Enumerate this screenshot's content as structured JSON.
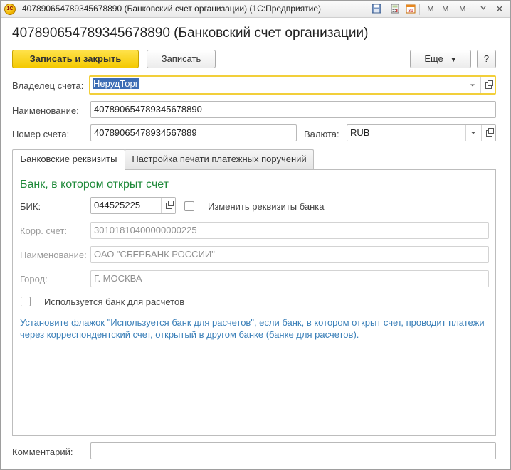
{
  "window": {
    "title": "40789065478934567889­0 (Банковский счет организации)  (1С:Предприятие)",
    "logo_text": "1С",
    "toolbar_icons": [
      "save-icon",
      "calculator-icon",
      "calendar-icon",
      "m-icon",
      "m-plus-icon",
      "m-minus-icon",
      "close-icon"
    ],
    "m_label": "M",
    "m_plus_label": "M+",
    "m_minus_label": "M−",
    "close_glyph": "✕"
  },
  "header": {
    "title": "40789065478934567889­0 (Банковский счет организации)"
  },
  "toolbar": {
    "save_close_label": "Записать и закрыть",
    "save_label": "Записать",
    "more_label": "Еще",
    "help_label": "?"
  },
  "form": {
    "owner": {
      "label": "Владелец счета:",
      "value": "НерудТорг"
    },
    "name": {
      "label": "Наименование:",
      "value": "40789065478934567889­0"
    },
    "account": {
      "label": "Номер счета:",
      "value": "40789065478934567889"
    },
    "currency": {
      "label": "Валюта:",
      "value": "RUB"
    },
    "comment": {
      "label": "Комментарий:",
      "value": ""
    }
  },
  "tabs": [
    {
      "label": "Банковские реквизиты",
      "active": true
    },
    {
      "label": "Настройка печати платежных поручений",
      "active": false
    }
  ],
  "bank": {
    "section_title": "Банк, в котором открыт счет",
    "bik": {
      "label": "БИК:",
      "value": "044525225"
    },
    "change_details_label": "Изменить реквизиты банка",
    "corr": {
      "label": "Корр. счет:",
      "value": "30101810400000000225"
    },
    "name": {
      "label": "Наименование:",
      "value": "ОАО \"СБЕРБАНК РОССИИ\""
    },
    "city": {
      "label": "Город:",
      "value": "Г. МОСКВА"
    },
    "settlement_bank_label": "Используется банк для расчетов",
    "hint": "Установите флажок \"Используется банк для расчетов\", если банк, в котором открыт счет, проводит платежи через корреспондентский счет, открытый в другом банке (банке для расчетов)."
  },
  "colors": {
    "accent_yellow": "#f4c900",
    "section_green": "#1f8a3a",
    "hint_blue": "#3a7fb8",
    "selection_blue": "#3d6db5"
  }
}
